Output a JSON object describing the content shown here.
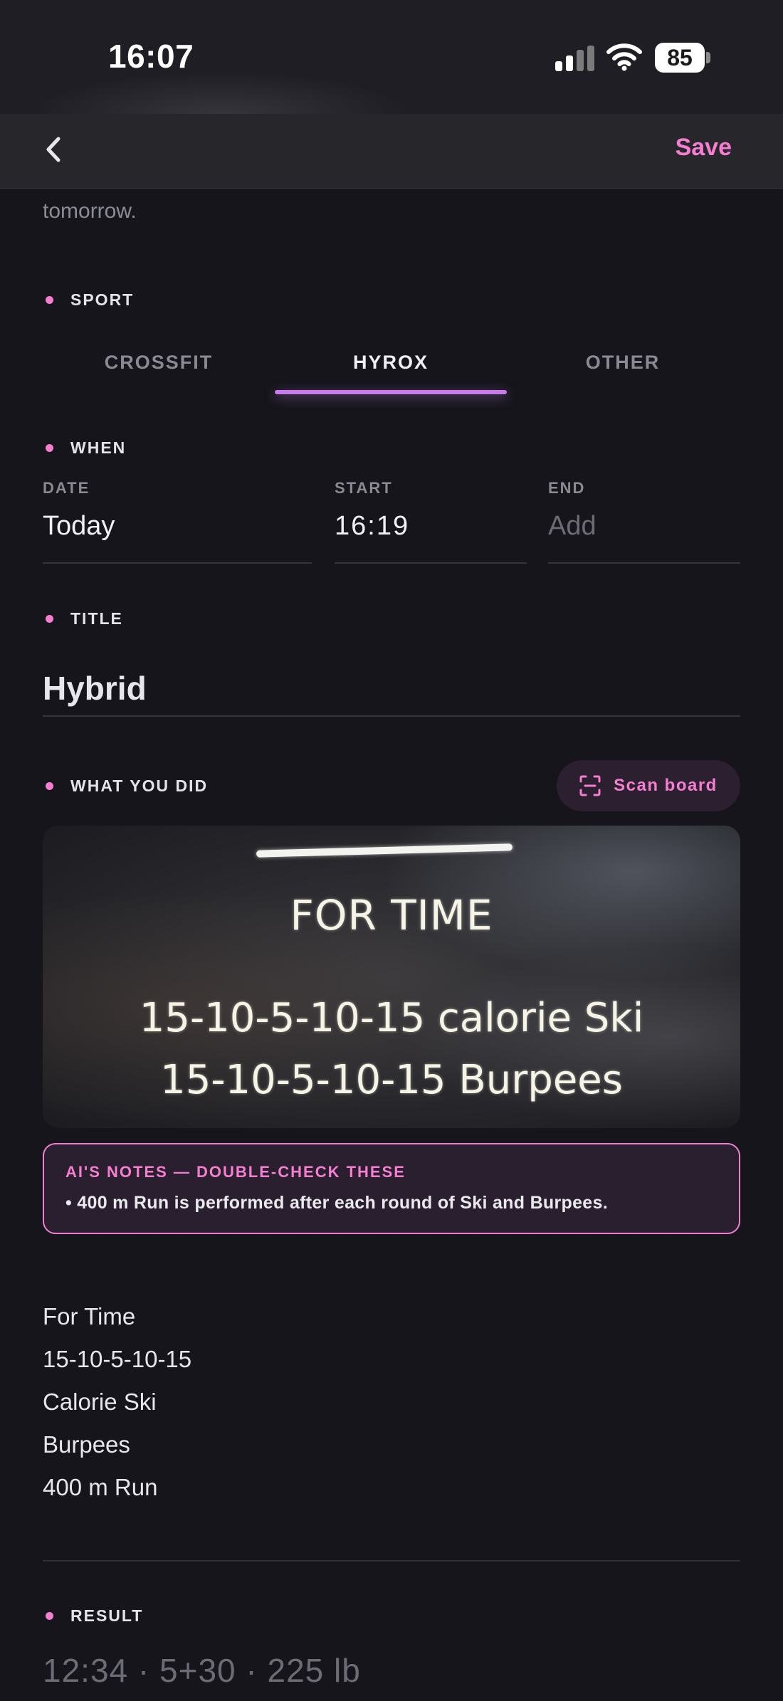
{
  "status_bar": {
    "time": "16:07",
    "battery": "85"
  },
  "nav": {
    "save_label": "Save",
    "back_icon": "chevron-left-icon"
  },
  "intro": {
    "text_tail": "tomorrow."
  },
  "sport": {
    "label": "SPORT",
    "tabs": [
      {
        "label": "CROSSFIT",
        "active": false
      },
      {
        "label": "HYROX",
        "active": true
      },
      {
        "label": "OTHER",
        "active": false
      }
    ]
  },
  "when": {
    "label": "WHEN",
    "date": {
      "label": "DATE",
      "value": "Today"
    },
    "start": {
      "label": "START",
      "value": "16:19"
    },
    "end": {
      "label": "END",
      "placeholder": "Add"
    }
  },
  "title": {
    "label": "TITLE",
    "value": "Hybrid"
  },
  "what_you_did": {
    "label": "WHAT YOU DID",
    "scan_button": "Scan board",
    "board_lines": [
      "FOR TIME",
      "15-10-5-10-15 calorie Ski",
      "15-10-5-10-15 Burpees"
    ],
    "ai_notes": {
      "heading": "AI'S NOTES — DOUBLE-CHECK THESE",
      "items": [
        "• 400 m Run is performed after each round of Ski and Burpees."
      ]
    },
    "workout_lines": [
      "For Time",
      "15-10-5-10-15",
      "Calorie Ski",
      "Burpees",
      "400 m Run"
    ]
  },
  "result": {
    "label": "RESULT",
    "placeholder": "12:34 · 5+30 · 225 lb"
  },
  "colors": {
    "accent": "#f47fd0",
    "tab_underline": "#c77be8",
    "background": "#15151b"
  }
}
